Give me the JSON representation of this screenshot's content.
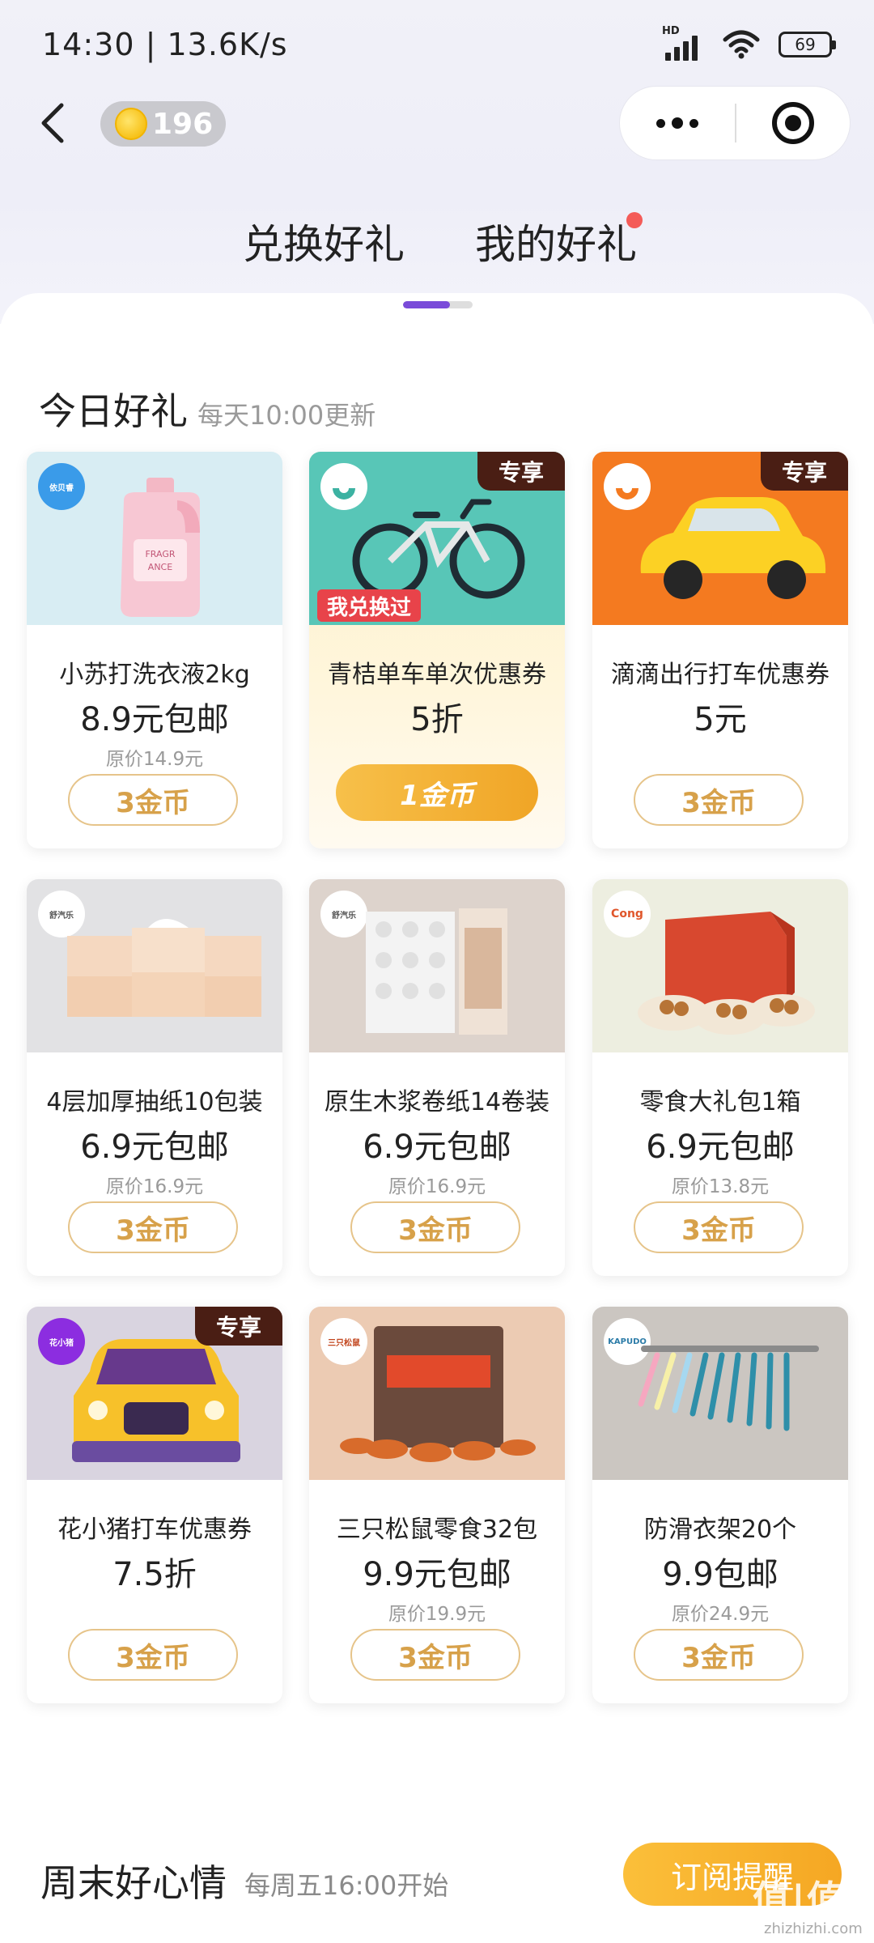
{
  "status_bar": {
    "time_speed": "14:30 | 13.6K/s",
    "network_label": "HD",
    "battery": "69"
  },
  "header": {
    "coins": "196"
  },
  "tabs": {
    "exchange": "兑换好礼",
    "mine": "我的好礼"
  },
  "today": {
    "title": "今日好礼",
    "subtitle": "每天10:00更新"
  },
  "products": [
    {
      "name": "小苏打洗衣液2kg",
      "price": "8.9元包邮",
      "original": "原价14.9元",
      "cost": "3金币",
      "brand": "依贝睿"
    },
    {
      "name": "青桔单车单次优惠券",
      "price": "5折",
      "original": "",
      "cost": "1金币",
      "tag": "专享",
      "redeemed": "我兑换过"
    },
    {
      "name": "滴滴出行打车优惠券",
      "price": "5元",
      "original": "",
      "cost": "3金币",
      "tag": "专享"
    },
    {
      "name": "4层加厚抽纸10包装",
      "price": "6.9元包邮",
      "original": "原价16.9元",
      "cost": "3金币",
      "brand": "舒汽乐"
    },
    {
      "name": "原生木浆卷纸14卷装",
      "price": "6.9元包邮",
      "original": "原价16.9元",
      "cost": "3金币",
      "brand": "舒汽乐"
    },
    {
      "name": "零食大礼包1箱",
      "price": "6.9元包邮",
      "original": "原价13.8元",
      "cost": "3金币",
      "brand": "Cong"
    },
    {
      "name": "花小猪打车优惠券",
      "price": "7.5折",
      "original": "",
      "cost": "3金币",
      "tag": "专享",
      "brand": "花小猪"
    },
    {
      "name": "三只松鼠零食32包",
      "price": "9.9元包邮",
      "original": "原价19.9元",
      "cost": "3金币",
      "brand": "三只松鼠"
    },
    {
      "name": "防滑衣架20个",
      "price": "9.9包邮",
      "original": "原价24.9元",
      "cost": "3金币",
      "brand": "KAPUDO"
    }
  ],
  "weekend": {
    "title": "周末好心情",
    "subtitle": "每周五16:00开始",
    "button": "订阅提醒"
  },
  "watermark": {
    "main": "值|值|值",
    "sub": "zhizhizhi.com"
  },
  "colors": {
    "accent": "#7a4bd9",
    "coin_gold": "#d7a14a",
    "exclusive_tag": "#4a1e14",
    "redeemed_tag": "#e8434a"
  }
}
